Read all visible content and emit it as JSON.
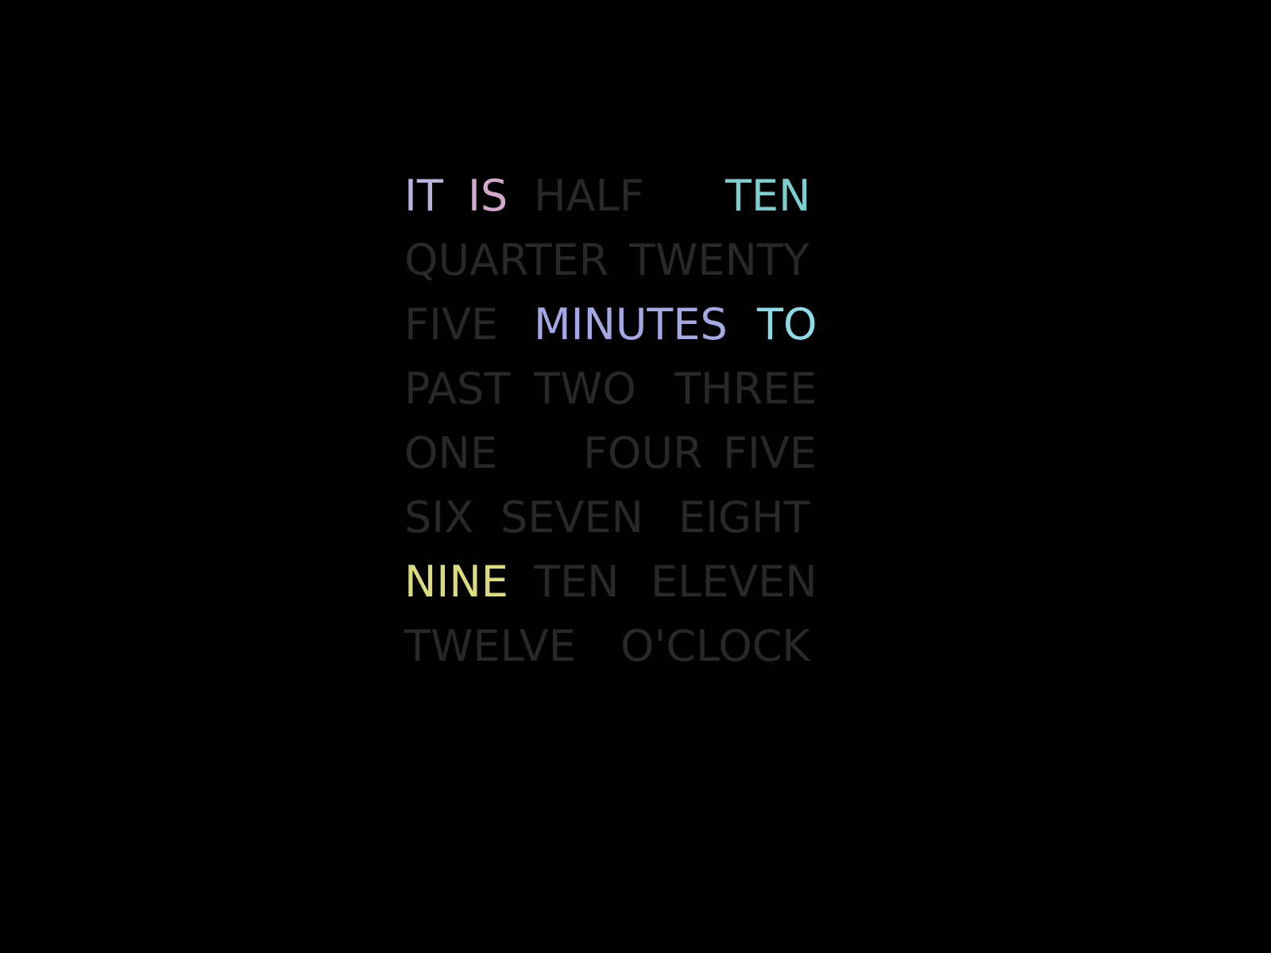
{
  "colors": {
    "background": "#000000",
    "inactive": "#282828",
    "it": "#b8b4e0",
    "is": "#d4a8cc",
    "ten_minutes": "#7ccfcf",
    "minutes": "#a4a8e4",
    "to": "#8cdce8",
    "nine": "#dcdc7c"
  },
  "rows": [
    [
      {
        "text": "IT",
        "lit": true,
        "color": "it"
      },
      {
        "text": "IS",
        "lit": true,
        "color": "is"
      },
      {
        "text": "HALF",
        "lit": false
      },
      {
        "text": "TEN",
        "lit": true,
        "color": "ten_minutes"
      }
    ],
    [
      {
        "text": "QUARTER",
        "lit": false
      },
      {
        "text": "TWENTY",
        "lit": false
      }
    ],
    [
      {
        "text": "FIVE",
        "lit": false
      },
      {
        "text": "MINUTES",
        "lit": true,
        "color": "minutes"
      },
      {
        "text": "TO",
        "lit": true,
        "color": "to"
      }
    ],
    [
      {
        "text": "PAST",
        "lit": false
      },
      {
        "text": "TWO",
        "lit": false
      },
      {
        "text": "THREE",
        "lit": false
      }
    ],
    [
      {
        "text": "ONE",
        "lit": false
      },
      {
        "text": "FOUR",
        "lit": false
      },
      {
        "text": "FIVE",
        "lit": false
      }
    ],
    [
      {
        "text": "SIX",
        "lit": false
      },
      {
        "text": "SEVEN",
        "lit": false
      },
      {
        "text": "EIGHT",
        "lit": false
      }
    ],
    [
      {
        "text": "NINE",
        "lit": true,
        "color": "nine"
      },
      {
        "text": "TEN",
        "lit": false
      },
      {
        "text": "ELEVEN",
        "lit": false
      }
    ],
    [
      {
        "text": "TWELVE",
        "lit": false
      },
      {
        "text": "O'CLOCK",
        "lit": false
      }
    ]
  ]
}
